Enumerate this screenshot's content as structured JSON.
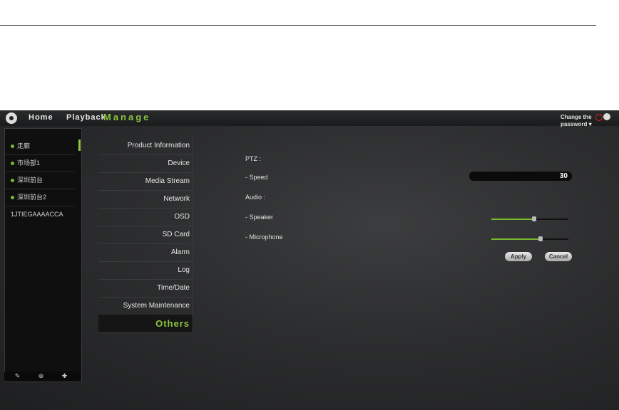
{
  "topbar": {
    "nav": [
      "Home",
      "Playback",
      "Manage"
    ],
    "change_password": "Change the password ▾"
  },
  "devices": [
    "走廊",
    "市场部1",
    "深圳前台",
    "深圳前台2",
    "1JTIEGAAAACCA"
  ],
  "menu": {
    "items": [
      "Product Information",
      "Device",
      "Media Stream",
      "Network",
      "OSD",
      "SD Card",
      "Alarm",
      "Log",
      "Time/Date",
      "System Maintenance",
      "Others"
    ],
    "active": "Others"
  },
  "settings": {
    "ptz_label": "PTZ :",
    "speed_label": "- Speed",
    "speed_value": "30",
    "audio_label": "Audio :",
    "speaker_label": "- Speaker",
    "speaker_level": 0.56,
    "microphone_label": "- Microphone",
    "microphone_level": 0.64
  },
  "buttons": {
    "apply": "Apply",
    "cancel": "Cancel"
  },
  "colors": {
    "accent": "#8dc63f",
    "background": "#2c2d2e",
    "panel": "#0f0f10"
  },
  "icons": [
    "logo-icon",
    "power-icon",
    "globe-icon",
    "wrench-icon",
    "zoom-icon",
    "add-icon"
  ]
}
